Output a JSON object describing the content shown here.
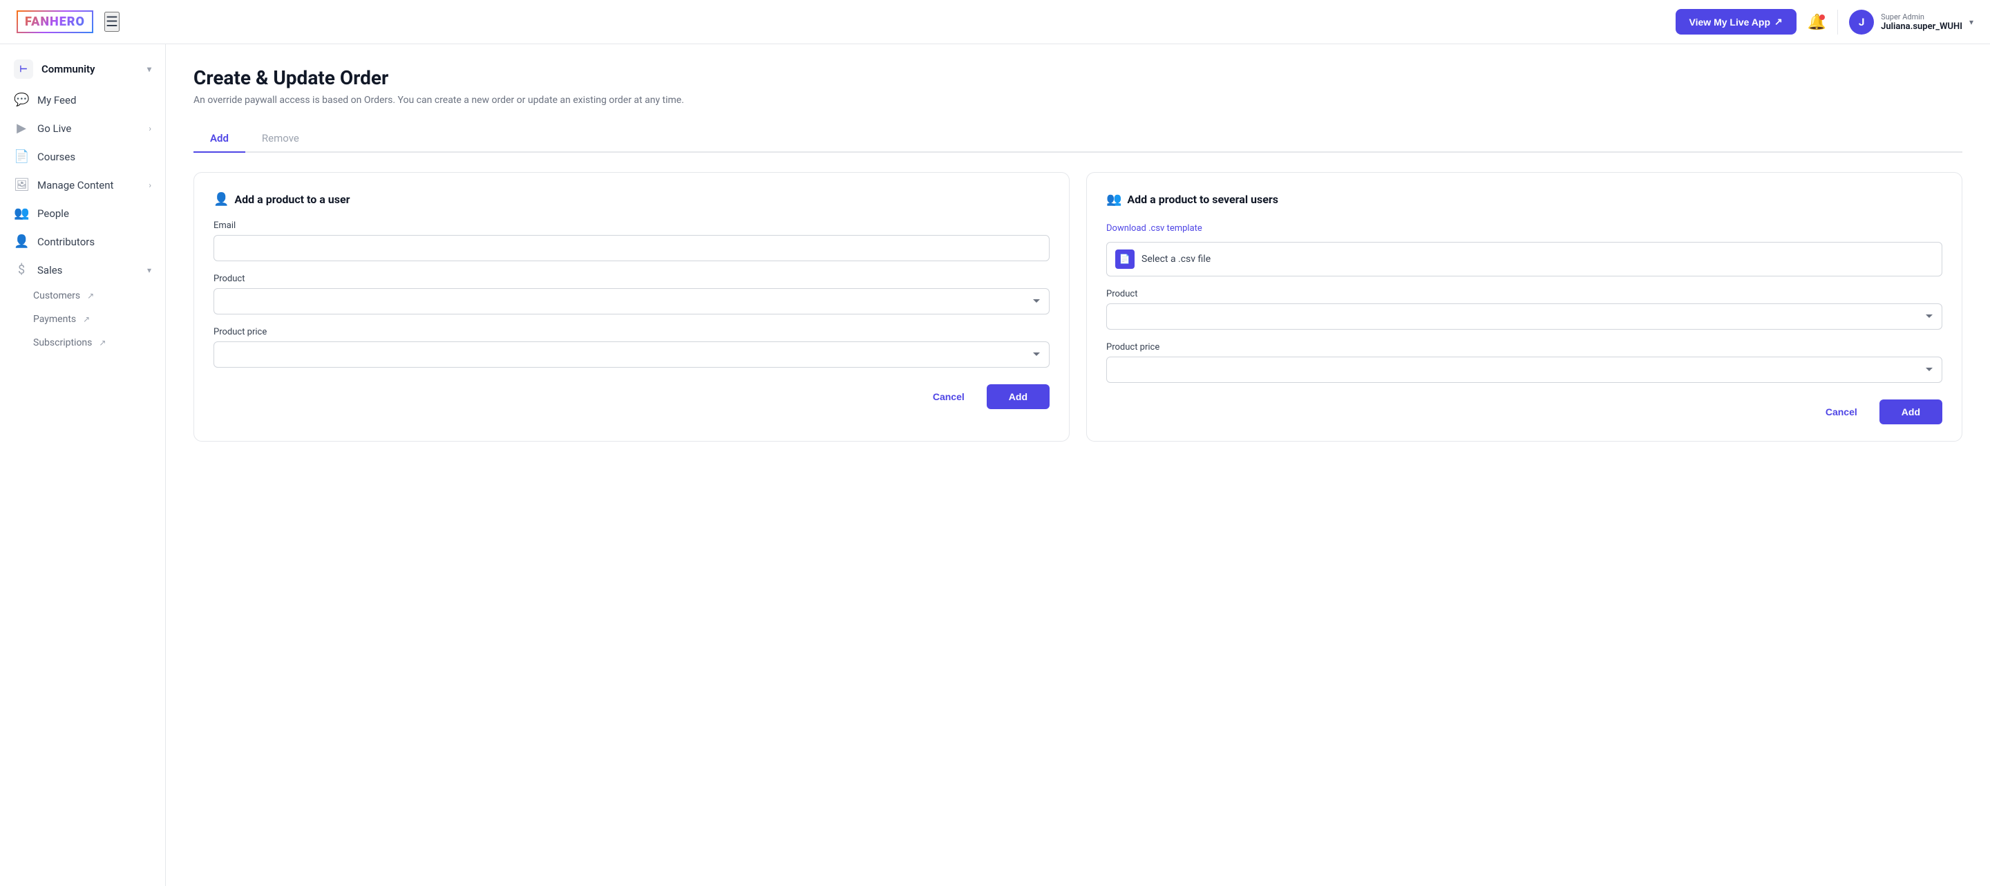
{
  "topnav": {
    "logo": "FANHERO",
    "view_live_label": "View My Live App",
    "view_live_icon": "↗",
    "user": {
      "initial": "J",
      "role": "Super Admin",
      "name": "Juliana.super_WUHI"
    }
  },
  "sidebar": {
    "community": {
      "label": "Community",
      "icon": "F"
    },
    "items": [
      {
        "id": "my-feed",
        "label": "My Feed",
        "icon": "💬",
        "arrow": false
      },
      {
        "id": "go-live",
        "label": "Go Live",
        "icon": "▶",
        "arrow": true
      },
      {
        "id": "courses",
        "label": "Courses",
        "icon": "📄",
        "arrow": false
      },
      {
        "id": "manage-content",
        "label": "Manage Content",
        "icon": "🖼",
        "arrow": true
      },
      {
        "id": "people",
        "label": "People",
        "icon": "👥",
        "arrow": false
      },
      {
        "id": "contributors",
        "label": "Contributors",
        "icon": "👤",
        "arrow": false
      },
      {
        "id": "sales",
        "label": "Sales",
        "icon": "$",
        "arrow": true
      }
    ],
    "sub_items": [
      {
        "id": "customers",
        "label": "Customers",
        "ext": true
      },
      {
        "id": "payments",
        "label": "Payments",
        "ext": true
      },
      {
        "id": "subscriptions",
        "label": "Subscriptions",
        "ext": true
      }
    ]
  },
  "page": {
    "title": "Create & Update Order",
    "subtitle": "An override paywall access is based on Orders. You can create a new order or update an existing order at any time.",
    "tabs": [
      {
        "id": "add",
        "label": "Add",
        "active": true
      },
      {
        "id": "remove",
        "label": "Remove",
        "active": false
      }
    ]
  },
  "card_single": {
    "title": "Add a product to a user",
    "icon": "👤",
    "email_label": "Email",
    "email_placeholder": "",
    "product_label": "Product",
    "product_price_label": "Product price",
    "cancel_label": "Cancel",
    "add_label": "Add"
  },
  "card_bulk": {
    "title": "Add a product to several users",
    "icon": "👥+",
    "download_label": "Download .csv template",
    "csv_placeholder": "Select a .csv file",
    "product_label": "Product",
    "product_price_label": "Product price",
    "cancel_label": "Cancel",
    "add_label": "Add"
  }
}
